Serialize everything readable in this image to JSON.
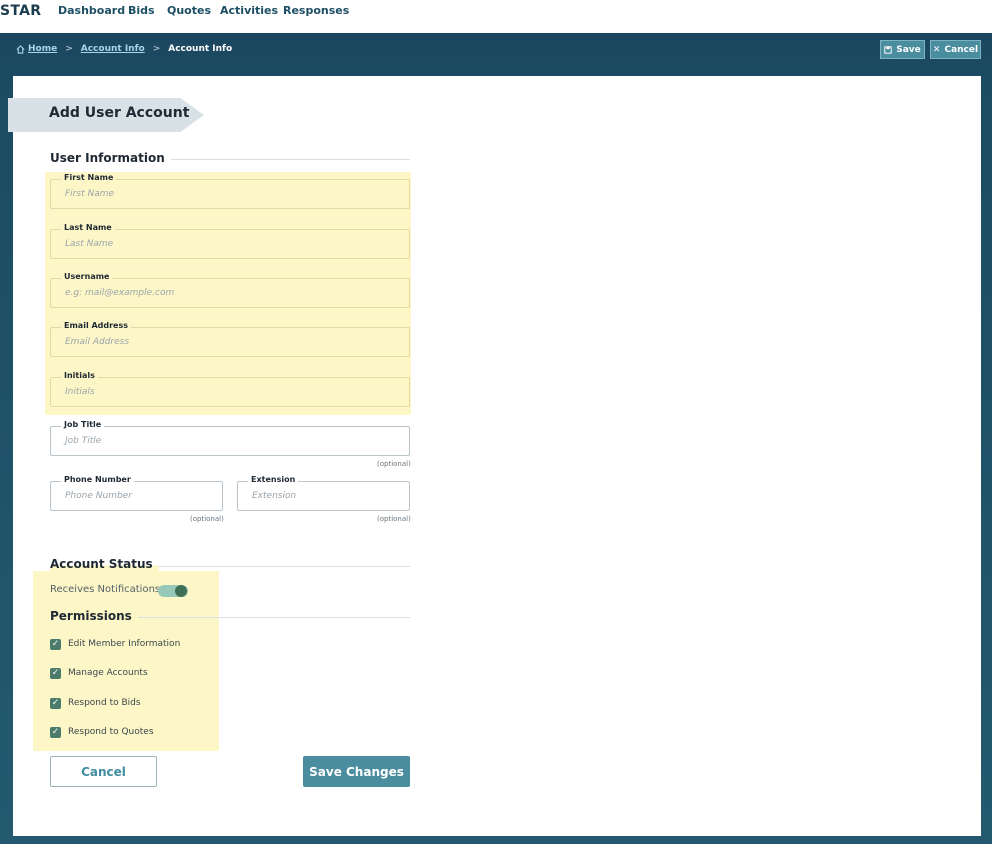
{
  "nav": {
    "logo": "STAR",
    "items": [
      "Dashboard",
      "Bids",
      "Quotes",
      "Activities",
      "Responses"
    ]
  },
  "breadcrumb": {
    "home_icon": "home-icon",
    "home": "Home",
    "account_info_link": "Account Info",
    "current": "Account Info",
    "separator": ">"
  },
  "header_actions": {
    "save_label": "Save",
    "save_icon": "floppy-disk-icon",
    "cancel_label": "Cancel",
    "cancel_icon": "close-icon"
  },
  "page": {
    "title": "Add User Account"
  },
  "user_info": {
    "heading": "User Information",
    "fields": {
      "first_name": {
        "label": "First Name",
        "placeholder": "First Name"
      },
      "last_name": {
        "label": "Last Name",
        "placeholder": "Last Name"
      },
      "username": {
        "label": "Username",
        "placeholder": "e.g: mail@example.com"
      },
      "email": {
        "label": "Email Address",
        "placeholder": "Email Address"
      },
      "initials": {
        "label": "Initials",
        "placeholder": "Initials"
      },
      "job_title": {
        "label": "Job Title",
        "placeholder": "Job Title",
        "note": "(optional)"
      },
      "phone": {
        "label": "Phone Number",
        "placeholder": "Phone Number",
        "note": "(optional)"
      },
      "extension": {
        "label": "Extension",
        "placeholder": "Extension",
        "note": "(optional)"
      }
    }
  },
  "account_status": {
    "heading": "Account Status",
    "notifications_label": "Receives Notifications",
    "notifications_on": true
  },
  "permissions": {
    "heading": "Permissions",
    "items": [
      {
        "label": "Edit Member Information",
        "checked": true
      },
      {
        "label": "Manage Accounts",
        "checked": true
      },
      {
        "label": "Respond to Bids",
        "checked": true
      },
      {
        "label": "Respond to Quotes",
        "checked": true
      }
    ]
  },
  "footer": {
    "cancel_label": "Cancel",
    "save_label": "Save Changes"
  },
  "colors": {
    "header_band": "#1b4b63",
    "accent": "#4a8d9f",
    "highlight": "#fdf6c6",
    "toggle_on": "#97c9b8",
    "checkbox": "#4b7c6b"
  }
}
